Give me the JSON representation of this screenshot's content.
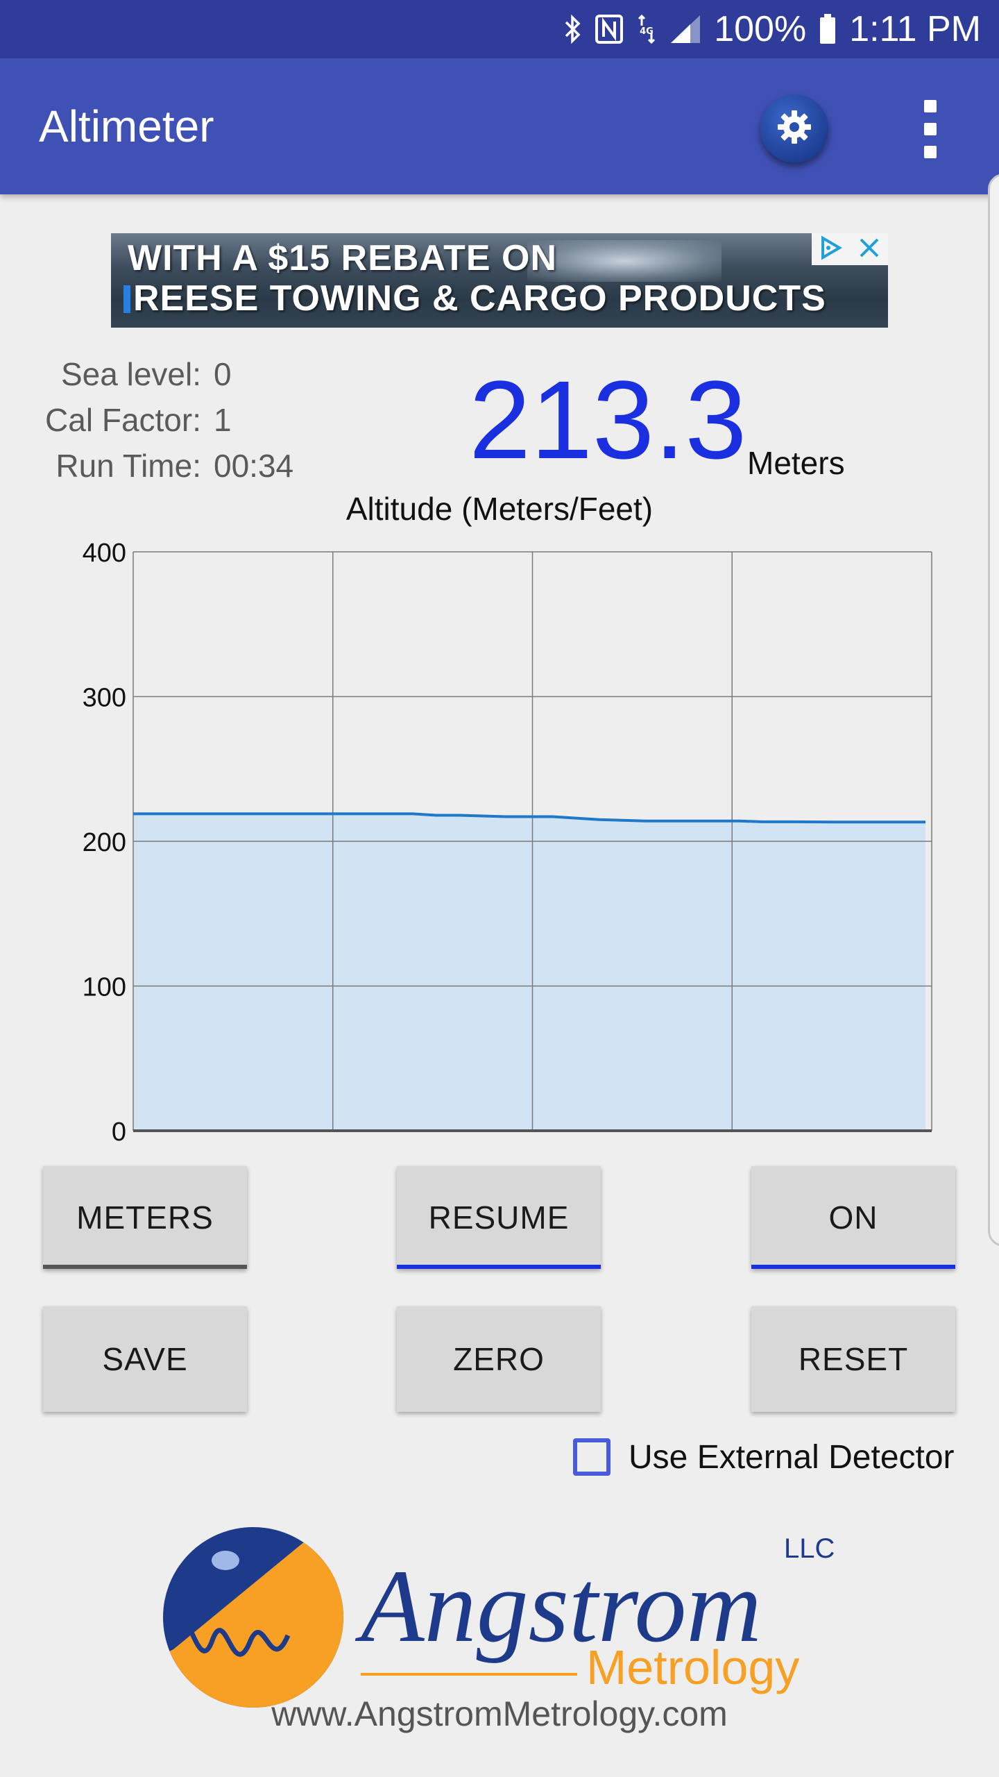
{
  "status_bar": {
    "battery": "100%",
    "time": "1:11 PM",
    "icons": [
      "bluetooth-icon",
      "nfc-icon",
      "data-4g-icon",
      "signal-icon",
      "battery-icon"
    ]
  },
  "app_bar": {
    "title": "Altimeter",
    "color": "#3f51b5",
    "icons": [
      "settings-gear-icon",
      "overflow-menu-icon"
    ]
  },
  "ad": {
    "line1": "WITH A $15 REBATE ON",
    "line2": "REESE TOWING & CARGO PRODUCTS"
  },
  "info": {
    "sea_level_label": "Sea level:",
    "sea_level_value": "0",
    "cal_factor_label": "Cal Factor:",
    "cal_factor_value": "1",
    "run_time_label": "Run Time:",
    "run_time_value": "00:34"
  },
  "reading": {
    "value": "213.3",
    "unit": "Meters",
    "color": "#1a2fe0"
  },
  "chart_data": {
    "type": "area",
    "title": "Altitude (Meters/Feet)",
    "xlabel": "",
    "ylabel": "",
    "ylim": [
      0,
      400
    ],
    "yticks": [
      "0",
      "100",
      "200",
      "300",
      "400"
    ],
    "grid": true,
    "vertical_gridlines": 4,
    "x": [
      0,
      2,
      4,
      6,
      8,
      10,
      12,
      13,
      14,
      16,
      18,
      20,
      22,
      24,
      26,
      27,
      28,
      30,
      32,
      34
    ],
    "series": [
      {
        "values": [
          219,
          219,
          219,
          219,
          219,
          219,
          219,
          218,
          218,
          217,
          217,
          215,
          214,
          214,
          214,
          213.5,
          213.5,
          213.3,
          213.3,
          213.3
        ],
        "line_color": "#1f78c8",
        "fill_color": "#d2e4f3"
      }
    ]
  },
  "buttons": {
    "meters": "METERS",
    "resume": "RESUME",
    "on": "ON",
    "save": "SAVE",
    "zero": "ZERO",
    "reset": "RESET"
  },
  "external_detector": {
    "label": "Use External Detector",
    "checked": false
  },
  "logo": {
    "name": "Angstrom",
    "suffix": "LLC",
    "sub": "Metrology",
    "url": "www.AngstromMetrology.com"
  }
}
